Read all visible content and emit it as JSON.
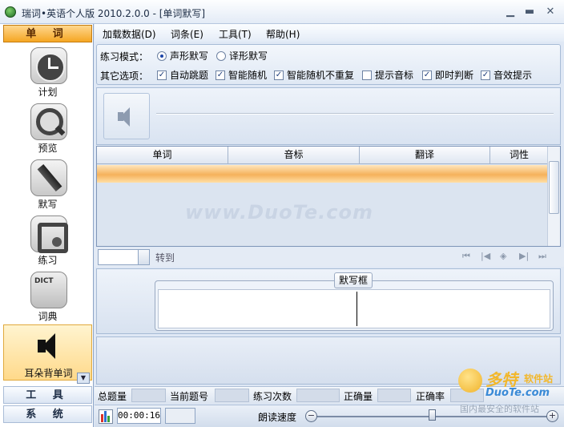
{
  "window": {
    "title": "瑞词•英语个人版 2010.2.0.0 - [单词默写]",
    "minimize": "▁",
    "maximize": "▬",
    "close": "✕"
  },
  "nav": {
    "header_words": "单 词",
    "items": [
      {
        "label": "计划",
        "icon": "clock-icon"
      },
      {
        "label": "预览",
        "icon": "magnifier-icon"
      },
      {
        "label": "默写",
        "icon": "pen-icon"
      },
      {
        "label": "练习",
        "icon": "practice-icon"
      },
      {
        "label": "词典",
        "icon": "dictionary-icon",
        "icon_text": "DICT"
      },
      {
        "label": "耳朵背单词",
        "icon": "speaker-icon"
      }
    ],
    "scroll_down": "▼",
    "header_tools": "工 具",
    "header_system": "系 统"
  },
  "menu": {
    "load_data": "加载数据(D)",
    "entries": "词条(E)",
    "tools": "工具(T)",
    "help": "帮助(H)"
  },
  "options": {
    "mode_label": "练习模式：",
    "mode_sound": "声形默写",
    "mode_translate": "译形默写",
    "other_label": "其它选项：",
    "auto_skip": "自动跳题",
    "smart_random": "智能随机",
    "smart_random_norepeat": "智能随机不重复",
    "show_phonetic": "提示音标",
    "instant_judge": "即时判断",
    "sound_hint": "音效提示",
    "check_mark": "✓"
  },
  "table": {
    "headers": [
      "单词",
      "音标",
      "翻译",
      "词性"
    ],
    "watermark": "www.DuoTe.com"
  },
  "pager": {
    "goto": "转到",
    "first": "⏮",
    "prev": "|◀",
    "center": "◈",
    "next": "▶|",
    "last": "⏭"
  },
  "dictation": {
    "title": "默写框"
  },
  "status": {
    "total": "总题量",
    "current": "当前题号",
    "practice_count": "练习次数",
    "correct": "正确量",
    "accuracy": "正确率"
  },
  "bottom": {
    "timer": "00:00:16",
    "speed_label": "朗读速度",
    "minus": "−",
    "plus": "+"
  },
  "watermark_logo": {
    "brand": "多特",
    "brand2": "软件站",
    "domain": "DuoTe.com",
    "slogan": "国内最安全的软件站"
  }
}
